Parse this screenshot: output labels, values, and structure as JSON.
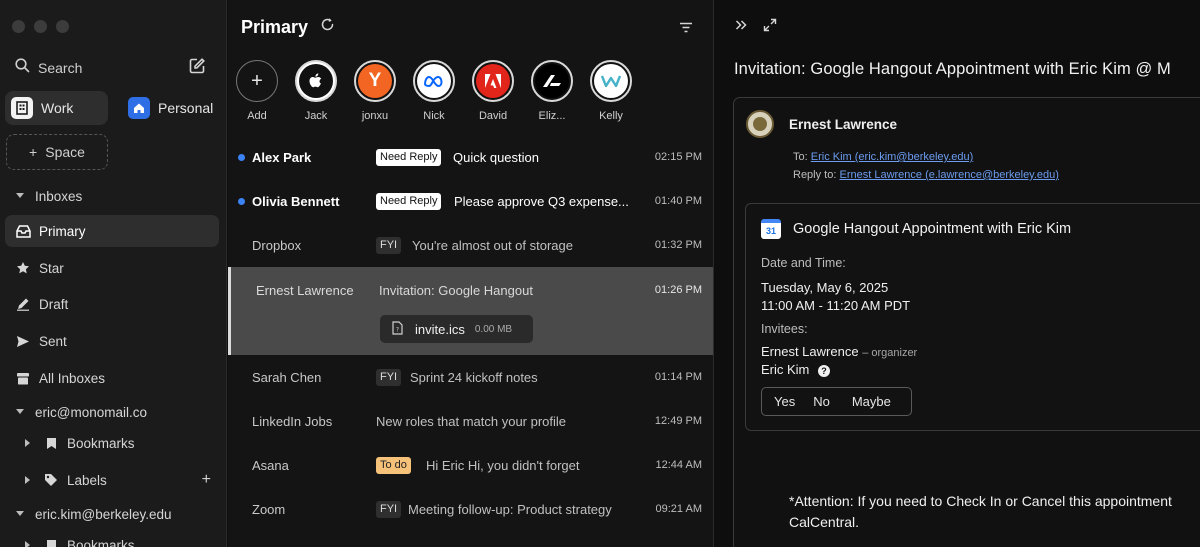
{
  "sidebar": {
    "search_label": "Search",
    "spaces": [
      {
        "label": "Work",
        "active": true
      },
      {
        "label": "Personal",
        "active": false
      }
    ],
    "add_space_label": "Space",
    "nav": {
      "inboxes": "Inboxes",
      "primary": "Primary",
      "star": "Star",
      "draft": "Draft",
      "sent": "Sent",
      "all_inboxes": "All Inboxes",
      "account1": "eric@monomail.co",
      "bookmarks1": "Bookmarks",
      "labels": "Labels",
      "account2": "eric.kim@berkeley.edu",
      "bookmarks2": "Bookmarks"
    }
  },
  "list": {
    "title": "Primary",
    "contacts": [
      {
        "name": "Add",
        "icon": "plus-icon"
      },
      {
        "name": "Jack",
        "icon": "apple-logo"
      },
      {
        "name": "jonxu",
        "icon": "y-logo"
      },
      {
        "name": "Nick",
        "icon": "meta-logo"
      },
      {
        "name": "David",
        "icon": "adobe-logo"
      },
      {
        "name": "Eliz...",
        "icon": "arc-logo"
      },
      {
        "name": "Kelly",
        "icon": "waymo-logo"
      }
    ],
    "emails": [
      {
        "sender": "Alex Park",
        "tag": "Need Reply",
        "subject": "Quick question",
        "time": "02:15 PM",
        "unread": true
      },
      {
        "sender": "Olivia Bennett",
        "tag": "Need Reply",
        "subject": "Please approve Q3 expense...",
        "time": "01:40 PM",
        "unread": true
      },
      {
        "sender": "Dropbox",
        "tag": "FYI",
        "subject": "You're almost out of storage",
        "time": "01:32 PM",
        "unread": false
      },
      {
        "sender": "Ernest Lawrence",
        "tag": "",
        "subject": "Invitation: Google Hangout",
        "time": "01:26 PM",
        "unread": false,
        "selected": true,
        "attachment": {
          "name": "invite.ics",
          "size": "0.00 MB"
        }
      },
      {
        "sender": "Sarah Chen",
        "tag": "FYI",
        "subject": "Sprint 24 kickoff notes",
        "time": "01:14 PM",
        "unread": false
      },
      {
        "sender": "LinkedIn Jobs",
        "tag": "",
        "subject": "New roles that match your profile",
        "time": "12:49 PM",
        "unread": false
      },
      {
        "sender": "Asana",
        "tag": "To do",
        "subject": "Hi Eric  Hi, you didn't forget",
        "time": "12:44 AM",
        "unread": false
      },
      {
        "sender": "Zoom",
        "tag": "FYI",
        "subject": "Meeting follow-up: Product strategy",
        "time": "09:21 AM",
        "unread": false
      }
    ]
  },
  "reader": {
    "title": "Invitation: Google Hangout Appointment with Eric Kim @ M",
    "from": "Ernest Lawrence",
    "to_label": "To:",
    "to_value": "Eric Kim (eric.kim@berkeley.edu)",
    "reply_label": "Reply to:",
    "reply_value": "Ernest Lawrence (e.lawrence@berkeley.edu)",
    "event": {
      "calendar_day": "31",
      "title": "Google Hangout Appointment with Eric Kim",
      "datetime_label": "Date and Time:",
      "date": "Tuesday, May 6, 2025",
      "time": "11:00 AM - 11:20 AM PDT",
      "invitees_label": "Invitees:",
      "organizer_name": "Ernest Lawrence",
      "organizer_role": "– organizer",
      "invitee2": "Eric Kim",
      "rsvp": [
        "Yes",
        "No",
        "Maybe"
      ]
    },
    "attention_line1": "*Attention: If you need to Check In or Cancel this appointment",
    "attention_line2": "CalCentral."
  },
  "colors": {
    "unread_dot": "#3b82f6",
    "todo_tag": "#f6c27a",
    "link": "#6b9cf0",
    "personal_space": "#2f6fe6"
  }
}
